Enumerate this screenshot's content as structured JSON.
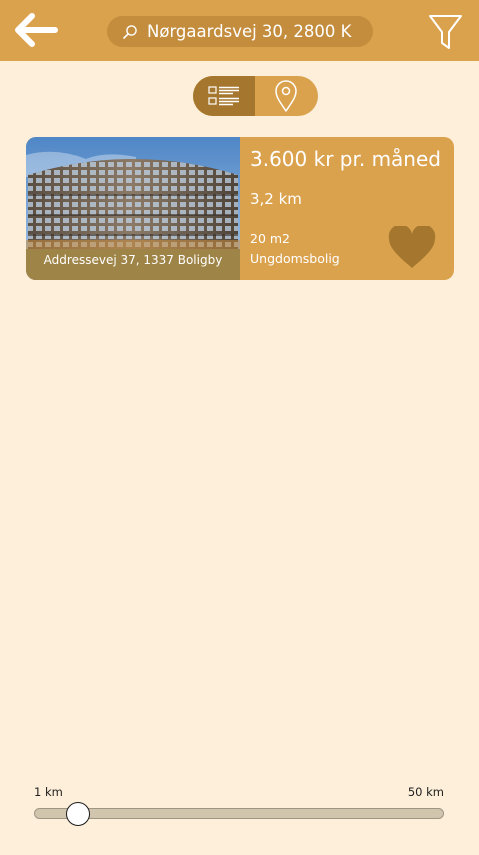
{
  "header": {
    "back_icon": "arrow-left-icon",
    "search": {
      "icon": "search-icon",
      "value": "Nørgaardsvej 30, 2800 K"
    },
    "filter_icon": "filter-funnel-icon"
  },
  "view_toggle": {
    "options": [
      {
        "icon": "list-icon",
        "selected": true
      },
      {
        "icon": "map-pin-icon",
        "selected": false
      }
    ]
  },
  "listings": [
    {
      "address": "Addressevej 37, 1337 Boligby",
      "price": "3.600 kr pr. måned",
      "distance": "3,2 km",
      "size": "20 m2",
      "type": "Ungdomsbolig",
      "favorite_icon": "heart-icon"
    }
  ],
  "distance_slider": {
    "min_label": "1 km",
    "max_label": "50 km",
    "min": 1,
    "max": 50,
    "value": 5
  },
  "colors": {
    "background": "#FDEFD9",
    "accent": "#DBA24E",
    "accent_dark": "#A5772E",
    "search_bg": "#C48D3E",
    "heart": "#A5772E"
  }
}
